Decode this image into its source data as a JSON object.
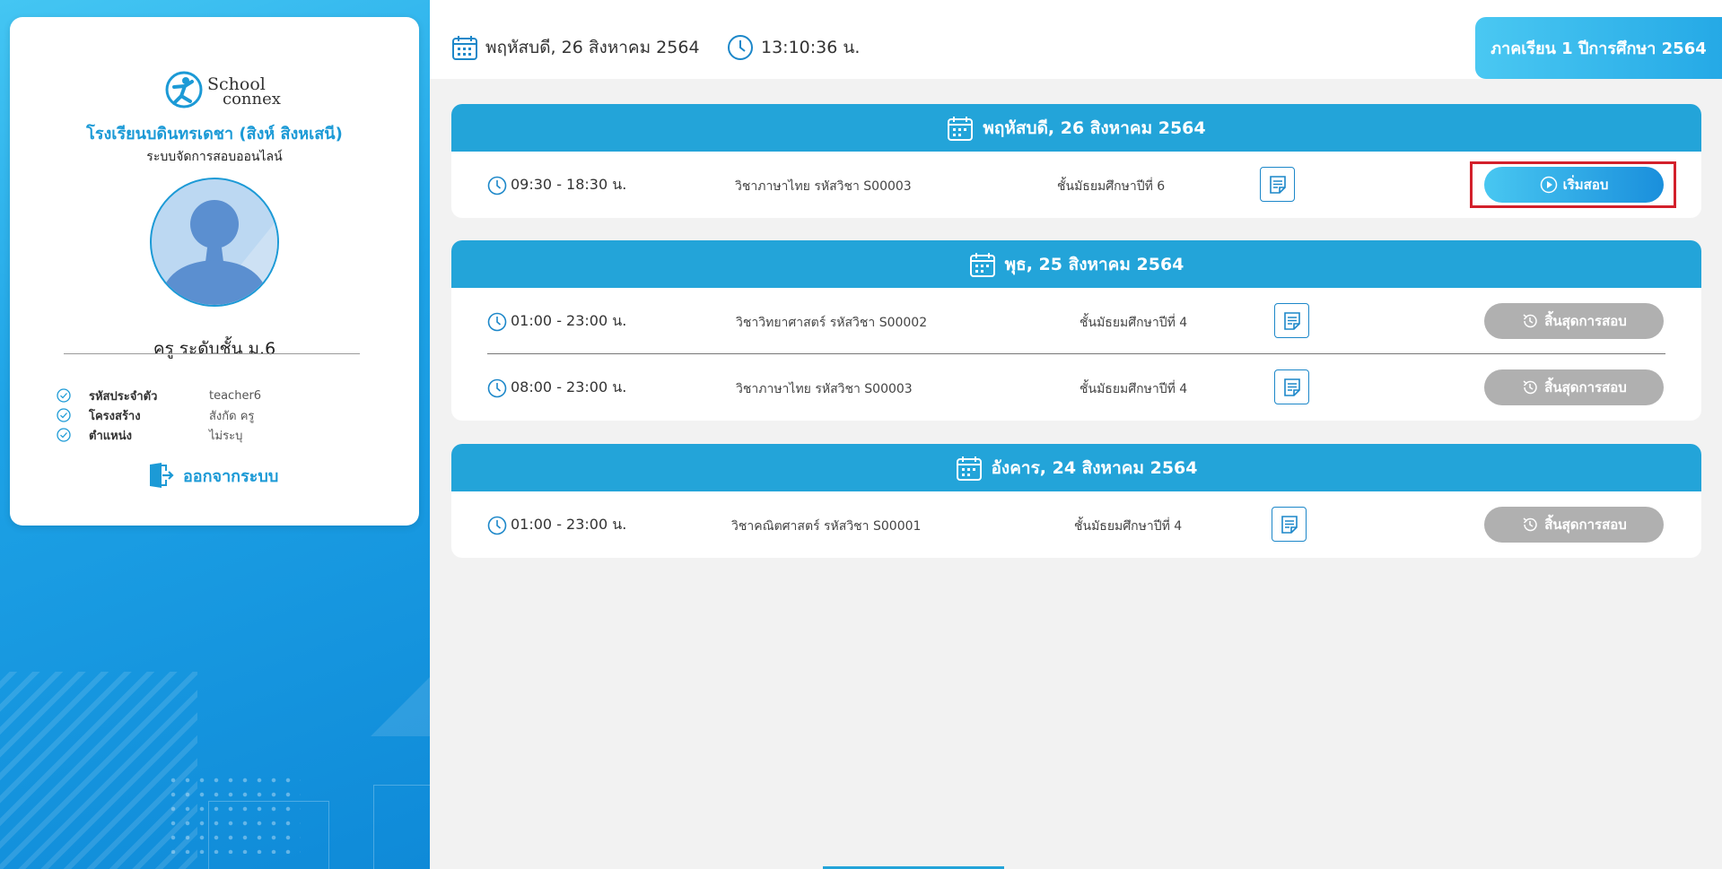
{
  "sidebar": {
    "logo": {
      "line1": "School",
      "line2": "connex"
    },
    "school_name": "โรงเรียนบดินทรเดชา (สิงห์ สิงหเสนี)",
    "system_name": "ระบบจัดการสอบออนไลน์",
    "role": "ครู ระดับชั้น ม.6",
    "info": [
      {
        "label": "รหัสประจำตัว",
        "value": "teacher6"
      },
      {
        "label": "โครงสร้าง",
        "value": "สังกัด ครู"
      },
      {
        "label": "ตำแหน่ง",
        "value": "ไม่ระบุ"
      }
    ],
    "logout_label": "ออกจากระบบ"
  },
  "topbar": {
    "date": "พฤหัสบดี, 26 สิงหาคม 2564",
    "time": "13:10:36 น.",
    "semester": "ภาคเรียน 1 ปีการศึกษา 2564"
  },
  "groups": [
    {
      "date": "พฤหัสบดี, 26 สิงหาคม 2564",
      "exams": [
        {
          "time": "09:30 - 18:30 น.",
          "subject": "วิชาภาษาไทย รหัสวิชา S00003",
          "grade": "ชั้นมัธยมศึกษาปีที่ 6",
          "button": "เริ่มสอบ",
          "status": "start"
        }
      ]
    },
    {
      "date": "พุธ, 25 สิงหาคม 2564",
      "exams": [
        {
          "time": "01:00 - 23:00 น.",
          "subject": "วิชาวิทยาศาสตร์ รหัสวิชา S00002",
          "grade": "ชั้นมัธยมศึกษาปีที่ 4",
          "button": "สิ้นสุดการสอบ",
          "status": "ended"
        },
        {
          "time": "08:00 - 23:00 น.",
          "subject": "วิชาภาษาไทย รหัสวิชา S00003",
          "grade": "ชั้นมัธยมศึกษาปีที่ 4",
          "button": "สิ้นสุดการสอบ",
          "status": "ended"
        }
      ]
    },
    {
      "date": "อังคาร, 24 สิงหาคม 2564",
      "exams": [
        {
          "time": "01:00 - 23:00 น.",
          "subject": "วิชาคณิตศาสตร์ รหัสวิชา S00001",
          "grade": "ชั้นมัธยมศึกษาปีที่ 4",
          "button": "สิ้นสุดการสอบ",
          "status": "ended"
        }
      ]
    }
  ],
  "colors": {
    "primary": "#23a4d9",
    "ended": "#b0b0b0",
    "highlight": "#d3202b"
  }
}
